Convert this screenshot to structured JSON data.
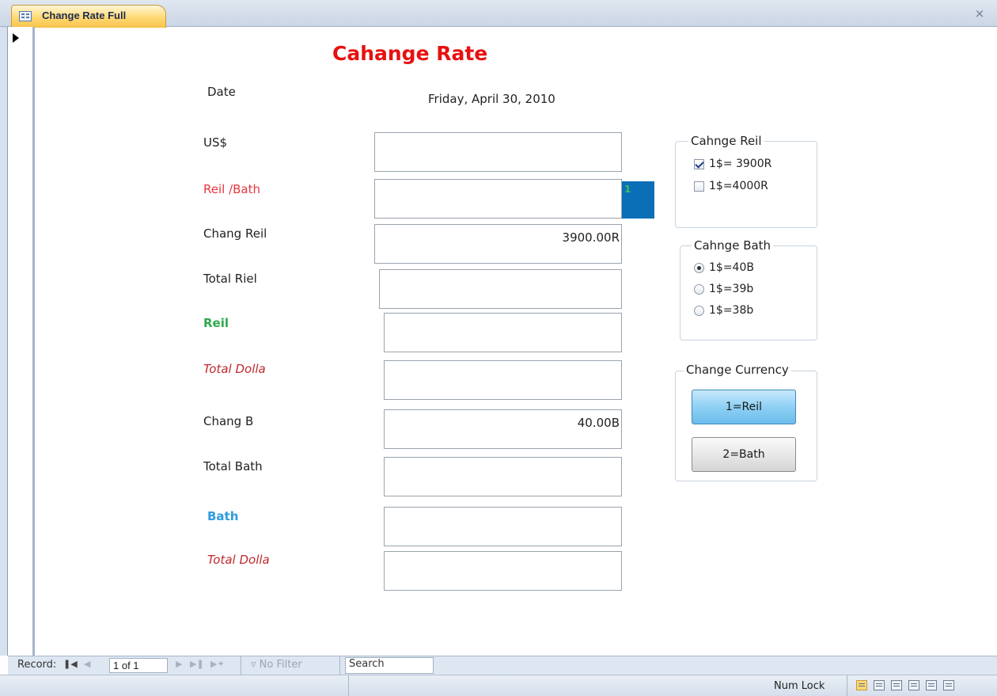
{
  "tab": {
    "title": "Change Rate Full",
    "close_glyph": "×"
  },
  "form": {
    "title": "Cahange Rate",
    "date_label": "Date",
    "date_value": "Friday, April 30, 2010",
    "labels": {
      "usd": "US$",
      "reil_bath": "Reil /Bath",
      "chang_reil": "Chang Reil",
      "total_riel": "Total Riel",
      "reil": "Reil",
      "total_dolla_1": "Total Dolla",
      "chang_b": "Chang B",
      "total_bath": "Total Bath",
      "bath": "Bath",
      "total_dolla_2": "Total Dolla"
    },
    "fields": {
      "usd": "",
      "reil_bath": "",
      "chang_reil": "3900.00R",
      "total_riel": "",
      "reil": "",
      "total_dolla_1": "",
      "chang_b": "40.00B",
      "total_bath": "",
      "bath": "",
      "total_dolla_2": ""
    },
    "indicator_value": "1"
  },
  "reil_group": {
    "legend": "Cahnge Reil",
    "options": [
      {
        "label": "1$= 3900R",
        "checked": true
      },
      {
        "label": "1$=4000R",
        "checked": false
      }
    ]
  },
  "bath_group": {
    "legend": "Cahnge Bath",
    "options": [
      {
        "label": "1$=40B",
        "selected": true
      },
      {
        "label": "1$=39b",
        "selected": false
      },
      {
        "label": "1$=38b",
        "selected": false
      }
    ]
  },
  "currency_group": {
    "legend": "Change Currency",
    "buttons": {
      "reil": "1=Reil",
      "bath": "2=Bath"
    }
  },
  "navbar": {
    "record_label": "Record:",
    "record_value": "1 of 1",
    "no_filter": "No Filter",
    "search": "Search"
  },
  "statusbar": {
    "text": "Num Lock"
  },
  "colors": {
    "title": "#e81010",
    "tab_active": "#ffd873",
    "button_active": "#8ed0f5",
    "indicator": "#0a6fb7"
  }
}
